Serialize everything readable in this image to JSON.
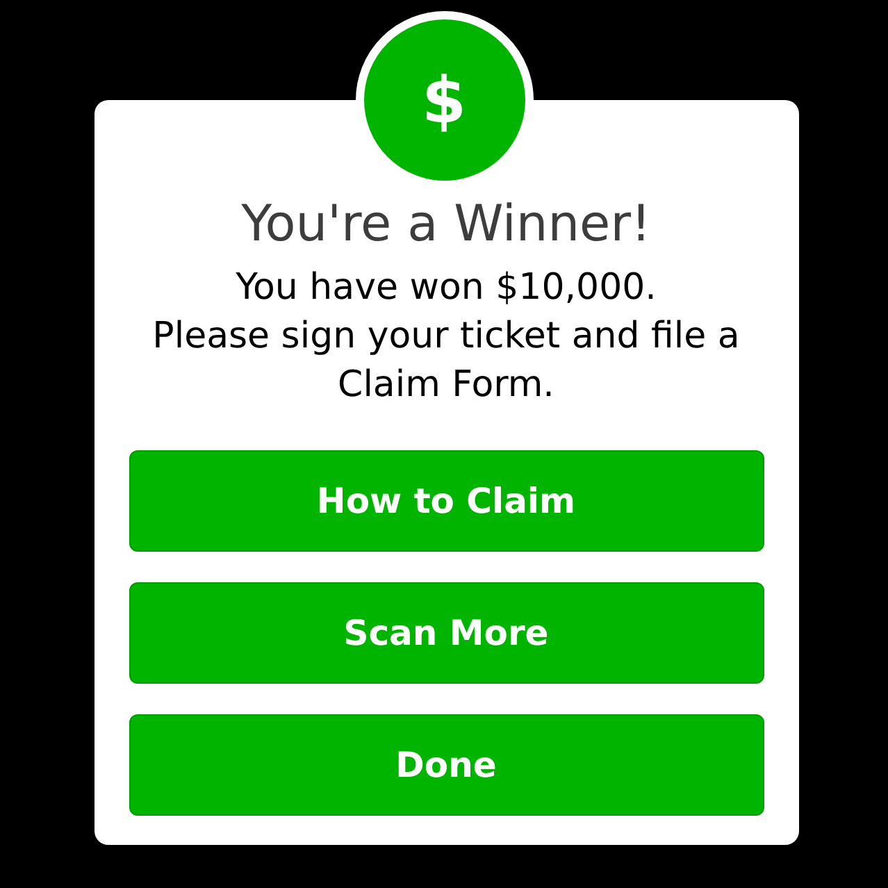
{
  "badge": {
    "symbol": "$"
  },
  "dialog": {
    "title": "You're a Winner!",
    "message_lines": [
      "You have won $10,000.",
      "Please sign your ticket and file a Claim Form."
    ]
  },
  "buttons": [
    {
      "label": "How to Claim"
    },
    {
      "label": "Scan More"
    },
    {
      "label": "Done"
    }
  ]
}
